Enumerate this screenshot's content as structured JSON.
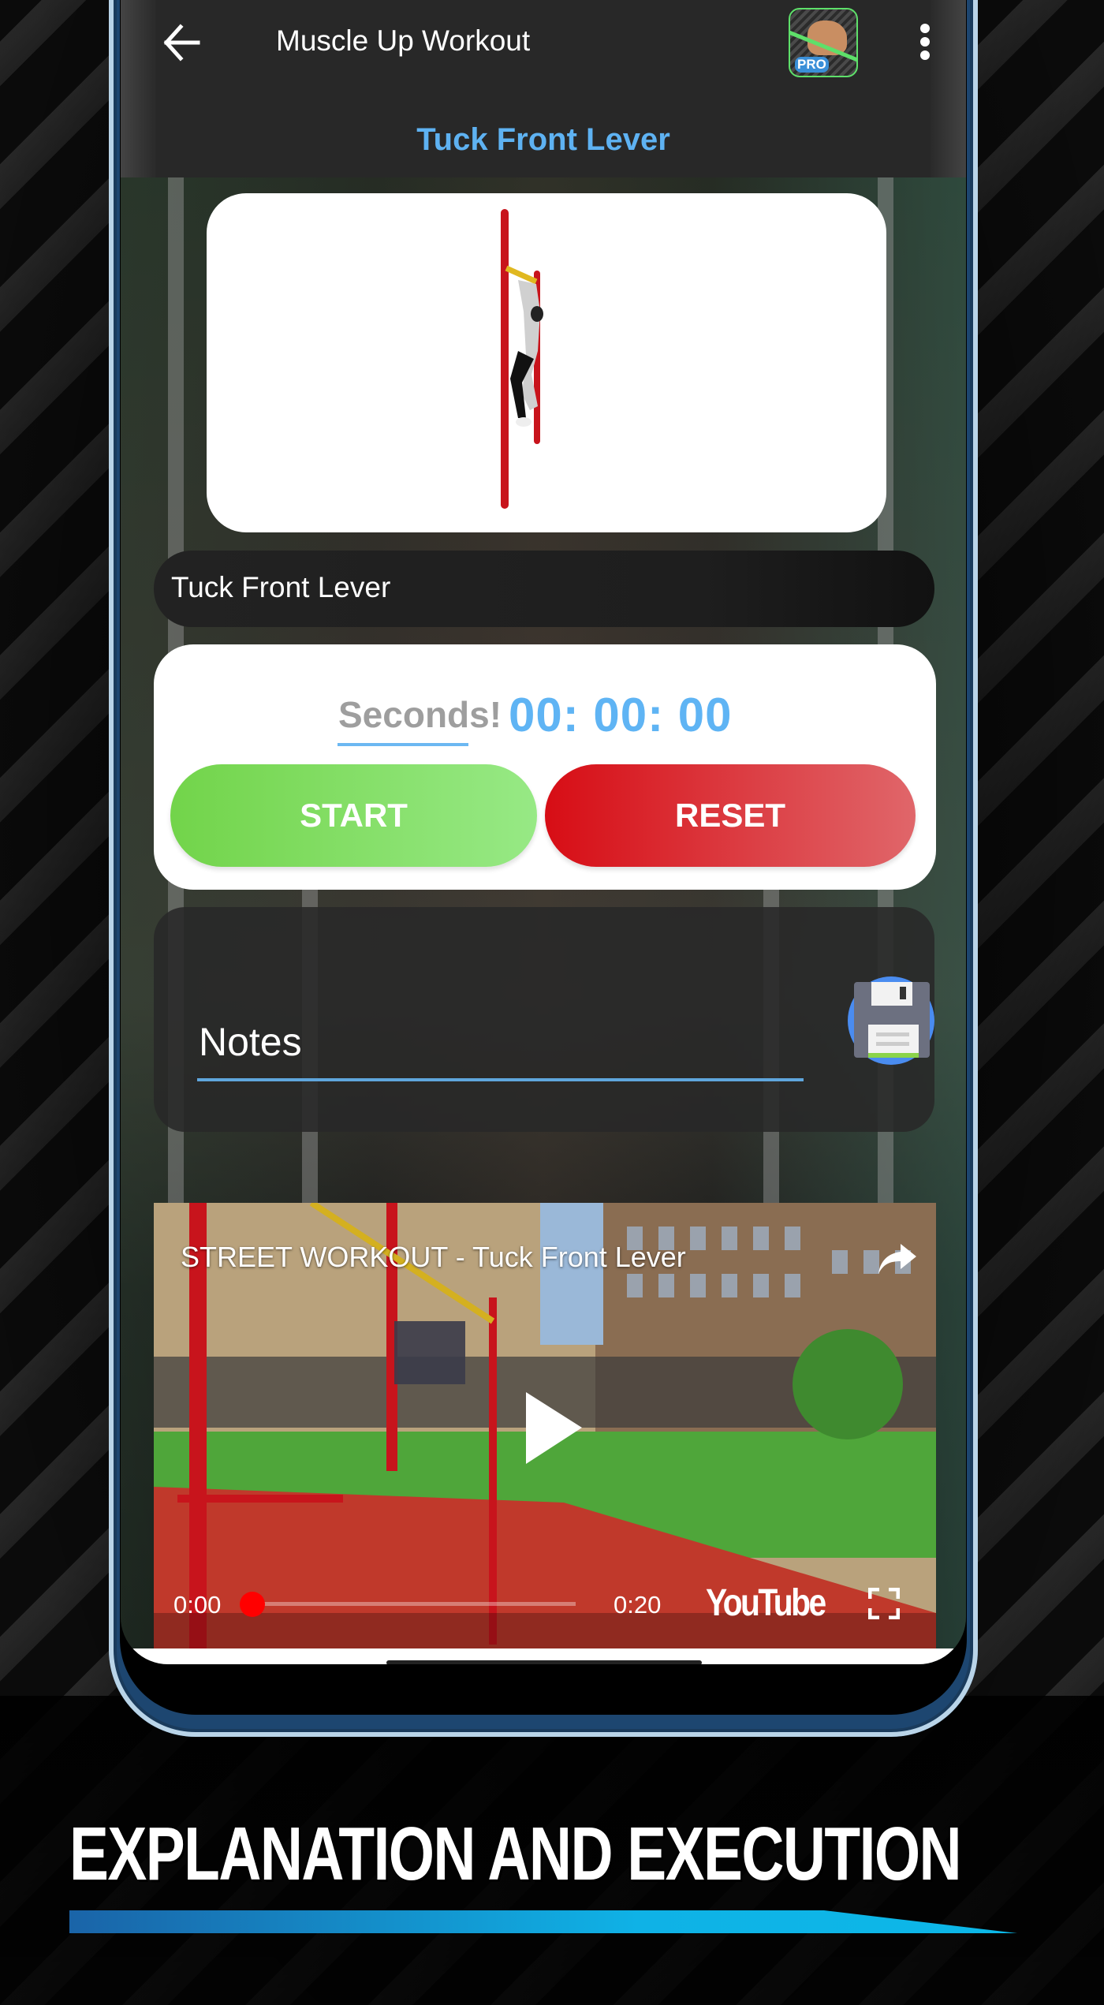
{
  "appbar": {
    "title": "Muscle Up Workout",
    "back_icon": "arrow-left-icon",
    "app_icon": "muscle-up-pro-app-icon",
    "app_icon_badge": "PRO",
    "menu_icon": "more-vertical-icon"
  },
  "exercise": {
    "heading": "Tuck Front Lever",
    "name": "Tuck Front Lever"
  },
  "timer": {
    "label": "Seconds!",
    "value": "00: 00: 00",
    "start_label": "START",
    "reset_label": "RESET"
  },
  "notes": {
    "placeholder": "Notes",
    "value": "",
    "save_icon": "floppy-disk-icon"
  },
  "video": {
    "title": "STREET WORKOUT - Tuck Front Lever",
    "current_time": "0:00",
    "duration": "0:20",
    "progress": 0,
    "brand": "YouTube",
    "share_icon": "share-icon",
    "play_icon": "play-icon",
    "fullscreen_icon": "fullscreen-icon"
  },
  "promo": {
    "headline": "EXPLANATION AND EXECUTION"
  },
  "colors": {
    "accent_blue": "#5eb2f2",
    "start_green": "#72d44a",
    "reset_red": "#d70d15",
    "appbar_bg": "#282828",
    "progress_red": "#ff0000"
  }
}
